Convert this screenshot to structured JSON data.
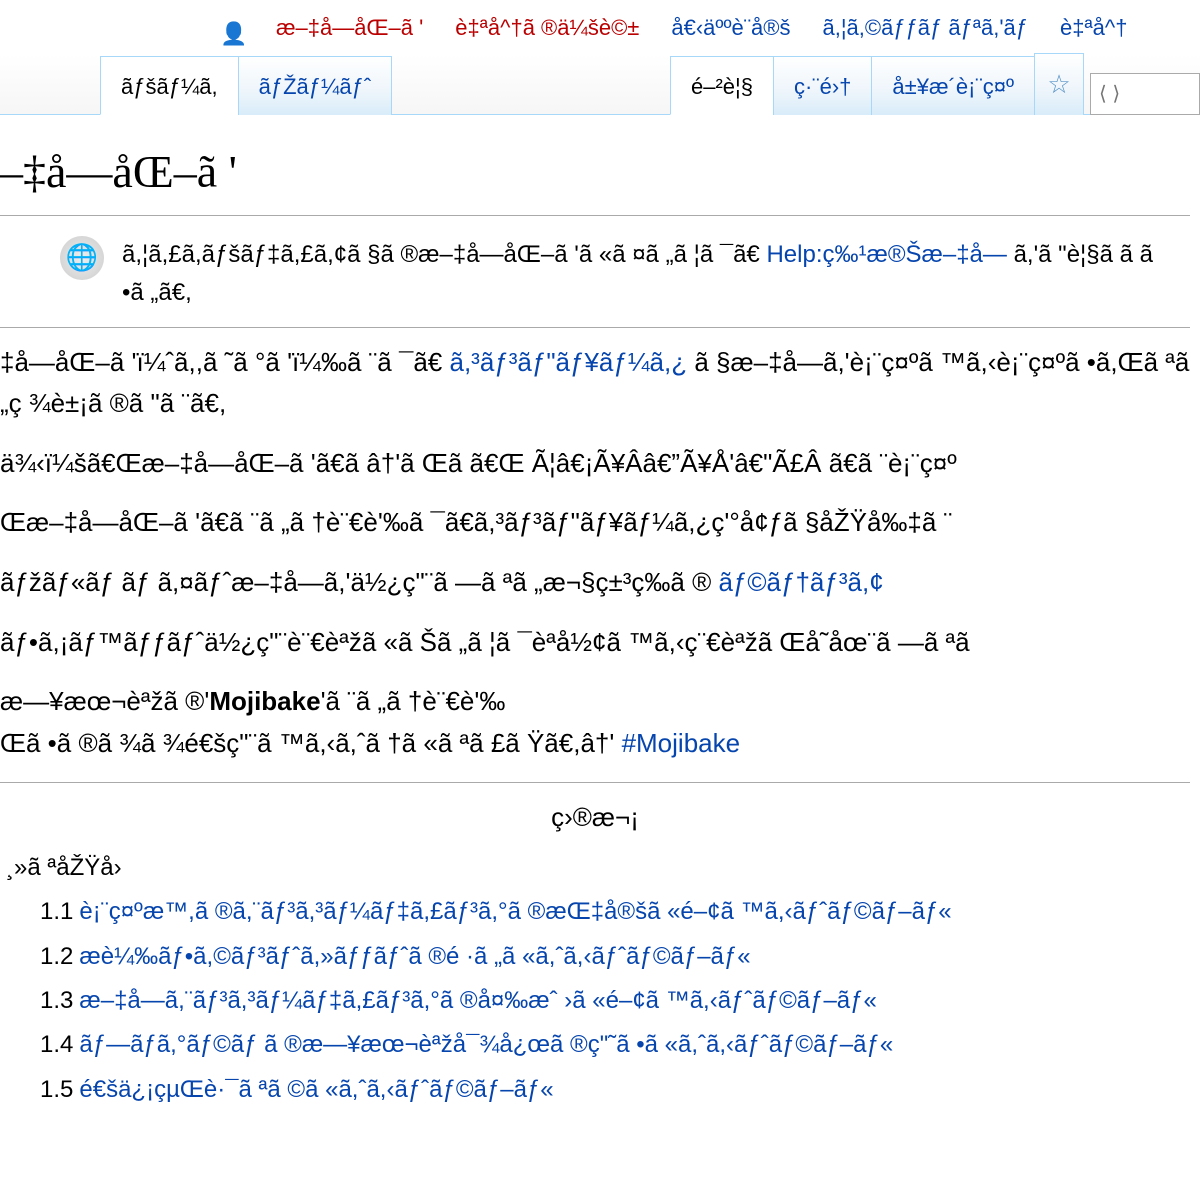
{
  "topnav": {
    "user_link": "æ–‡å—åŒ–ã '",
    "links": [
      "è‡ªå^†ã ®ä¼šè©±",
      "å€‹äººè¨å®š",
      "ã,¦ã,©ãƒƒãƒ ãƒªã,'ãƒ",
      "è‡ªå^†"
    ]
  },
  "tabs": {
    "left": [
      "ãƒšãƒ¼ã,",
      "ãƒŽãƒ¼ãƒˆ"
    ],
    "right": [
      "é–²è¦§",
      "ç·¨é›†",
      "å±¥æ­´è¡¨ç¤º"
    ]
  },
  "search_placeholder": "⟨ ⟩",
  "title": "–‡å—åŒ–ã '",
  "hatnote": {
    "text_pre": "ã,¦ã,£ã,­ãƒšãƒ‡ã,£ã,¢ã §ã ®æ–‡å—åŒ–ã 'ã «ã ¤ã „ã ¦ã ¯ã€",
    "link": "Help:ç‰¹æ®Šæ–‡å—",
    "text_post": "ã,'ã \"è¦§ã  ã  ã •ã „ã€,"
  },
  "paragraphs": [
    {
      "pre": "‡å—åŒ–ã 'ï¼ˆã,,ã ˜ã °ã 'ï¼‰ã ¨ã ¯ã€",
      "link": "ã,³ãƒ³ãƒ\"ãƒ¥ãƒ¼ã,¿",
      "post": "ã §æ–‡å—ã,'è¡¨ç¤ºã ™ã,‹è¡¨ç¤ºã •ã,Œã ªã „ç ¾è±¡ã ®ã \"ã ¨ã€,"
    },
    {
      "pre": "ä¾‹ï¼šã€Œæ–‡å—åŒ–ã 'ã€ã â†'ã Œã ã€Œ Ã¦â€¡Ã¥Â­â€”Ã¥Å'â€\"Ã£Â ã€ã ¨è¡¨ç¤º"
    },
    {
      "pre": "Œæ–‡å—åŒ–ã 'ã€ã ¨ã „ã †è¨€è'‰ã ¯ã€ã,³ãƒ³ãƒ\"ãƒ¥ãƒ¼ã,¿ç'°å¢ƒã §åŽŸå‰‡ã ¨"
    },
    {
      "pre": "ãƒžãƒ«ãƒ ãƒ ã,¤ãƒˆæ–‡å—ã,'ä½¿ç\"¨ã —ã ªã „æ¬§ç±³ç‰ã ®",
      "link": "ãƒ©ãƒ†ãƒ³ã,¢"
    },
    {
      "pre": "ãƒ•ã,¡ãƒ™ãƒƒãƒˆä½¿ç\"¨è¨€èªžã «ã Šã „ã ¦ã ¯èª­å½¢ã ™ã,‹ç¨€èªžã Œå­˜åœ¨ã —ã ªã"
    },
    {
      "pre": "æ—¥æœ¬èªžã ®'",
      "bold": "Mojibake",
      "post": "'ã ¨ã „ã †è¨€è'‰",
      "link2_pre": "Œã •ã ®ã ¾ã ¾é€šç\"¨ã ™ã,‹ã,ˆã †ã «ã ªã £ã Ÿã€,â†'",
      "link2": "#Mojibake"
    }
  ],
  "toc": {
    "title": "ç›®æ¬¡",
    "section": "¸»ã ªåŽŸå›",
    "items": [
      {
        "num": "1.1",
        "text": "è¡¨ç¤ºæ™,ã ®ã,¨ãƒ³ã,³ãƒ¼ãƒ‡ã,£ãƒ³ã,°ã ®æŒ‡å®šã «é–¢ã ™ã,‹ãƒˆãƒ©ãƒ–ãƒ«"
      },
      {
        "num": "1.2",
        "text": "æ­è¼‰ãƒ•ã,©ãƒ³ãƒˆã,»ãƒƒãƒˆã ®é ·ã „ã «ã,ˆã,‹ãƒˆãƒ©ãƒ–ãƒ«"
      },
      {
        "num": "1.3",
        "text": "æ–‡å—ã,¨ãƒ³ã,³ãƒ¼ãƒ‡ã,£ãƒ³ã,°ã ®å¤‰æˆ ›ã «é–¢ã ™ã,‹ãƒˆãƒ©ãƒ–ãƒ«"
      },
      {
        "num": "1.4",
        "text": "ãƒ—ãƒ­ã,°ãƒ©ãƒ ã ®æ—¥æœ¬èªžå¯¾å¿œã ®ç\"˜ã •ã «ã,ˆã,‹ãƒˆãƒ©ãƒ–ãƒ«"
      },
      {
        "num": "1.5",
        "text": "é€šä¿¡çµŒè·¯ã ªã ©ã «ã,ˆã,‹ãƒˆãƒ©ãƒ–ãƒ«"
      }
    ]
  }
}
